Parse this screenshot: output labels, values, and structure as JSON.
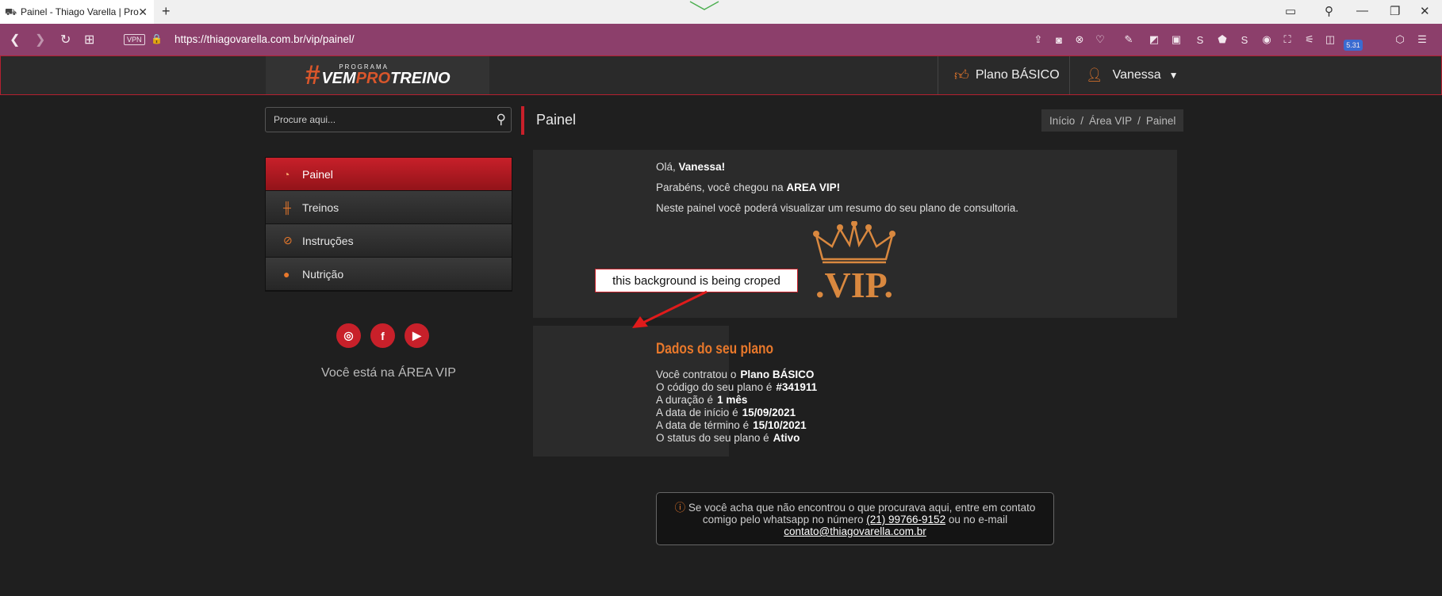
{
  "browser": {
    "tab_title": "Painel - Thiago Varella | Pro",
    "url": "https://thiagovarella.com.br/vip/painel/",
    "vpn_label": "VPN",
    "badge": "5.31"
  },
  "header": {
    "logo_small": "PROGRAMA",
    "logo_part1": "VEM",
    "logo_part2": "PRO",
    "logo_part3": "TREINO",
    "plan_label": "Plano BÁSICO",
    "user_name": "Vanessa"
  },
  "sidebar": {
    "search_placeholder": "Procure aqui...",
    "items": [
      {
        "label": "Painel",
        "icon": "gauge-icon"
      },
      {
        "label": "Treinos",
        "icon": "dumbbell-icon"
      },
      {
        "label": "Instruções",
        "icon": "paperclip-icon"
      },
      {
        "label": "Nutrição",
        "icon": "apple-icon"
      }
    ],
    "socials": [
      "instagram-icon",
      "facebook-icon",
      "youtube-icon"
    ],
    "vip_text": "Você está na ÁREA VIP"
  },
  "page": {
    "title": "Painel",
    "breadcrumb": [
      "Início",
      "Área VIP",
      "Painel"
    ]
  },
  "welcome": {
    "greeting_prefix": "Olá,",
    "greeting_name": "Vanessa!",
    "line2_prefix": "Parabéns, você chegou na",
    "line2_bold": "AREA VIP!",
    "line3": "Neste painel você poderá visualizar um resumo do seu plano de consultoria.",
    "vip_text": ".VIP."
  },
  "plan": {
    "title": "Dados do seu plano",
    "rows": [
      {
        "label": "Você contratou o",
        "value": "Plano BÁSICO"
      },
      {
        "label": "O código do seu plano é",
        "value": "#341911"
      },
      {
        "label": "A duração é",
        "value": "1 mês"
      },
      {
        "label": "A data de início é",
        "value": "15/09/2021"
      },
      {
        "label": "A data de término é",
        "value": "15/10/2021"
      },
      {
        "label": "O status do seu plano é",
        "value": "Ativo"
      }
    ]
  },
  "annotation": {
    "text": "this background is being croped"
  },
  "contact": {
    "line1": "Se você acha que não encontrou o que procurava aqui, entre em contato",
    "line2_prefix": "comigo pelo whatsapp no número",
    "phone": "(21) 99766-9152",
    "line2_suffix": "ou no e-mail",
    "email": "contato@thiagovarella.com.br"
  },
  "colors": {
    "accent_red": "#c8202a",
    "accent_orange": "#e8782b",
    "browser_bar": "#8c3f6b"
  }
}
